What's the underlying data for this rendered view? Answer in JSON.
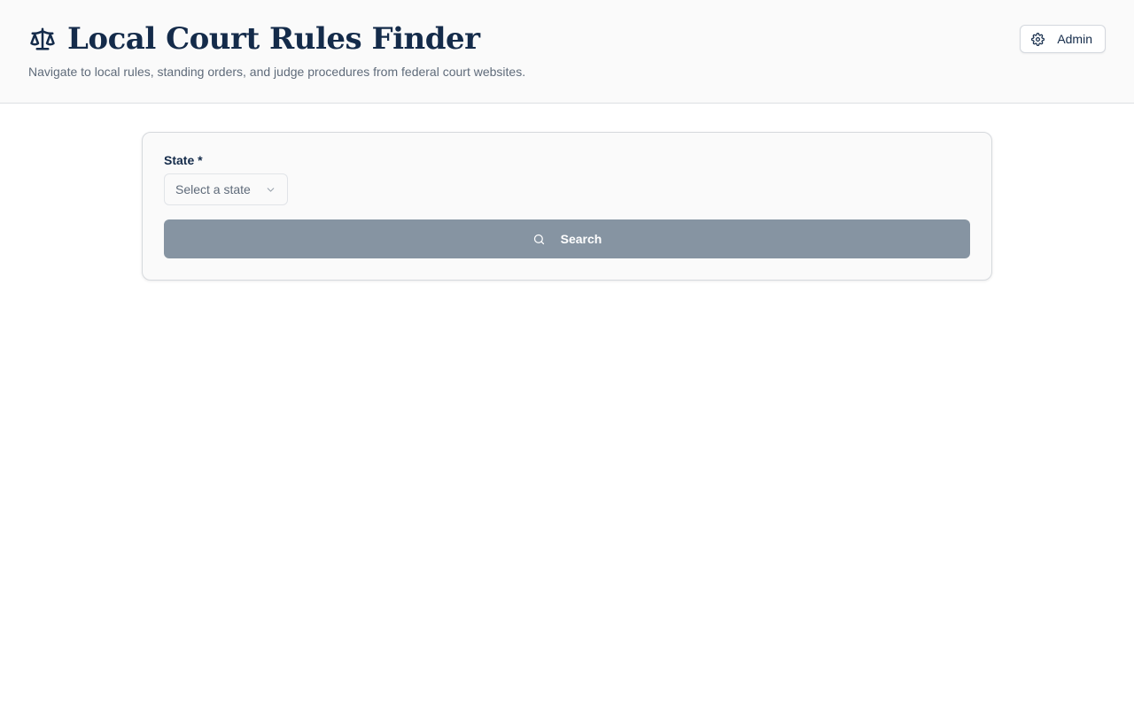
{
  "header": {
    "title": "Local Court Rules Finder",
    "subtitle": "Navigate to local rules, standing orders, and judge procedures from federal court websites.",
    "logo_icon": "scales-icon",
    "admin_button": {
      "label": "Admin",
      "icon": "gear-icon"
    }
  },
  "search_form": {
    "state_label": "State *",
    "state_select": {
      "placeholder": "Select a state",
      "selected": "",
      "icon": "chevron-down-icon"
    },
    "search_button": {
      "label": "Search",
      "icon": "search-icon"
    }
  },
  "colors": {
    "primary_text": "#142b4a",
    "muted_text": "#5f6b7a",
    "header_bg": "#fafafa",
    "search_button_bg": "#8694a2"
  }
}
